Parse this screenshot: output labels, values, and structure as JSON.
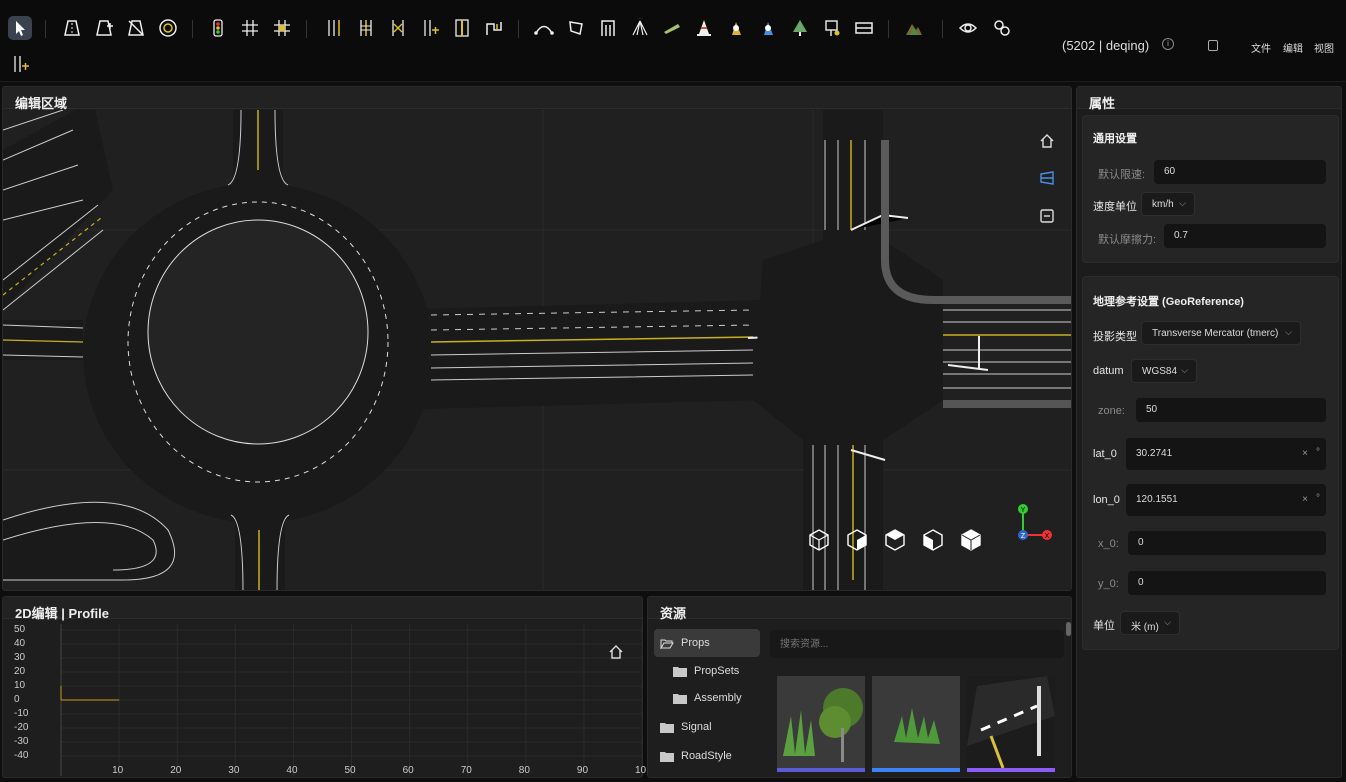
{
  "toolbar": {
    "tools": [
      "select-tool",
      "road-tool",
      "road-edit-tool",
      "road-delete-tool",
      "roundabout-tool",
      "traffic-light-tool",
      "junction-tool",
      "junction-edit-tool",
      "lane-add-tool",
      "lane-split-tool",
      "lane-merge-tool",
      "lane-insert-tool",
      "lane-width-tool",
      "lane-offset-tool",
      "curve-tool",
      "polygon-tool",
      "arch-tool",
      "crosswalk-tool",
      "bump-tool",
      "cone-tool",
      "prop-a-tool",
      "prop-b-tool",
      "tree-tool",
      "sign-tool",
      "barrier-tool",
      "terrain-tool",
      "view-tool",
      "link-tool",
      "lane-add-2-tool"
    ],
    "project": "(5202 | deqing)",
    "menus": [
      "文件",
      "编辑",
      "视图"
    ]
  },
  "editor": {
    "title": "编辑区域",
    "nav": [
      "home-icon",
      "perspective-icon",
      "collapse-icon"
    ],
    "cubes": [
      "view-cube-front-icon",
      "view-cube-right-icon",
      "view-cube-top-icon",
      "view-cube-left-icon",
      "view-cube-iso-icon"
    ],
    "axes": {
      "y": "Y",
      "z": "Z",
      "x": "X"
    }
  },
  "properties": {
    "title": "属性",
    "general": {
      "title": "通用设置",
      "speed_label": "默认限速:",
      "speed_value": "60",
      "unit_label": "速度单位",
      "unit_value": "km/h",
      "friction_label": "默认摩擦力:",
      "friction_value": "0.7"
    },
    "geo": {
      "title": "地理参考设置 (GeoReference)",
      "proj_label": "投影类型",
      "proj_value": "Transverse Mercator (tmerc)",
      "datum_label": "datum",
      "datum_value": "WGS84",
      "zone_label": "zone:",
      "zone_value": "50",
      "lat_label": "lat_0",
      "lat_value": "30.2741",
      "lon_label": "lon_0",
      "lon_value": "120.1551",
      "x_label": "x_0:",
      "x_value": "0",
      "y_label": "y_0:",
      "y_value": "0",
      "unit_label": "单位",
      "unit_value": "米 (m)",
      "deg": "°",
      "clear": "×"
    }
  },
  "profile": {
    "title": "2D编辑 | Profile",
    "chart_data": {
      "type": "line",
      "yticks": [
        "50",
        "40",
        "30",
        "20",
        "10",
        "0",
        "-10",
        "-20",
        "-30",
        "-40"
      ],
      "xticks": [
        "10",
        "20",
        "30",
        "40",
        "50",
        "60",
        "70",
        "80",
        "90",
        "10"
      ],
      "xlim": [
        0,
        100
      ],
      "ylim": [
        -45,
        50
      ],
      "series": [
        {
          "x": [
            0,
            10
          ],
          "y": [
            0,
            0
          ]
        }
      ],
      "grid": true
    }
  },
  "assets": {
    "title": "资源",
    "search_placeholder": "搜索资源...",
    "tree": [
      {
        "label": "Props",
        "level": 0,
        "open": true,
        "selected": true
      },
      {
        "label": "PropSets",
        "level": 1
      },
      {
        "label": "Assembly",
        "level": 1
      },
      {
        "label": "Signal",
        "level": 0
      },
      {
        "label": "RoadStyle",
        "level": 0
      }
    ],
    "thumbs": [
      {
        "accent": "#5b5bd6"
      },
      {
        "accent": "#3b82f6"
      },
      {
        "accent": "#8b5cf6"
      }
    ]
  }
}
